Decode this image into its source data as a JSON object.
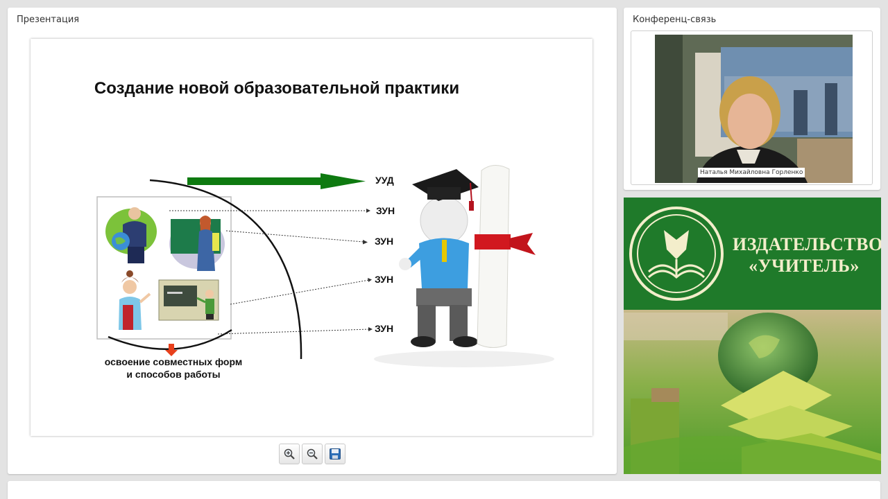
{
  "presentation": {
    "panel_title": "Презентация",
    "slide": {
      "title": "Создание новой образовательной практики",
      "labels": {
        "uud": "УУД",
        "zun": "ЗУН"
      },
      "caption_line1": "освоение совместных форм",
      "caption_line2": "и способов работы"
    },
    "toolbar": {
      "zoom_in_icon": "zoom-in-icon",
      "zoom_out_icon": "zoom-out-icon",
      "save_icon": "floppy-disk-icon"
    }
  },
  "conference": {
    "panel_title": "Конференц-связь",
    "participant_name": "Наталья Михайловна Горленко"
  },
  "publisher": {
    "name_line1": "ИЗДАТЕЛЬСТВО",
    "name_line2": "«УЧИТЕЛЬ»"
  },
  "colors": {
    "banner_green": "#1f7a2a",
    "arrow_green": "#0e7a10",
    "caption_arrow": "#e8401c"
  }
}
